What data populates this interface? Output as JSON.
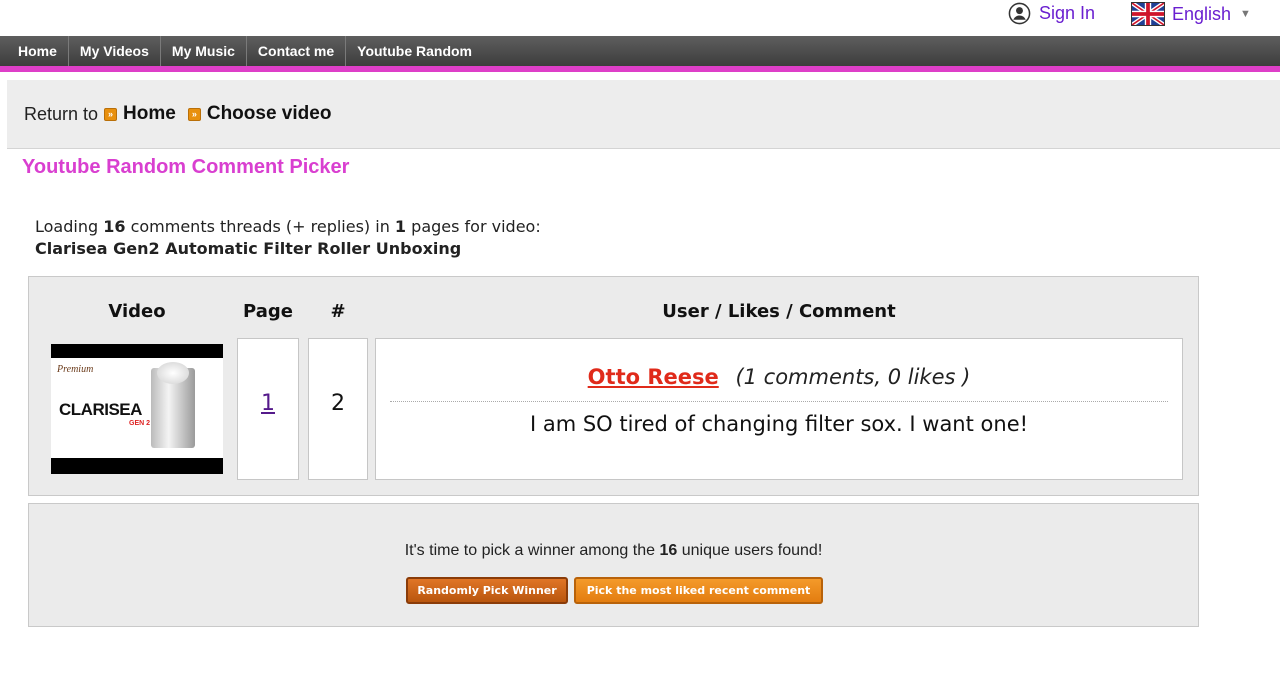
{
  "header": {
    "signin_label": "Sign In",
    "language_label": "English",
    "icons": {
      "signin": "user-circle-icon",
      "language": "uk-flag-icon",
      "caret": "chevron-down-icon"
    }
  },
  "nav": {
    "items": [
      {
        "label": "Home"
      },
      {
        "label": "My Videos"
      },
      {
        "label": "My Music"
      },
      {
        "label": "Contact me"
      },
      {
        "label": "Youtube Random"
      }
    ]
  },
  "breadcrumb": {
    "prefix": "Return to",
    "links": [
      {
        "label": "Home"
      },
      {
        "label": "Choose video"
      }
    ]
  },
  "title": "Youtube Random Comment Picker",
  "loading": {
    "text_1": "Loading",
    "comment_count": "16",
    "text_2": "comments threads (+ replies) in",
    "page_count": "1",
    "text_3": "pages for video:",
    "video_title": "Clarisea Gen2 Automatic Filter Roller Unboxing"
  },
  "results": {
    "columns": [
      {
        "label": "Video"
      },
      {
        "label": "Page"
      },
      {
        "label": "#"
      },
      {
        "label": "User / Likes / Comment"
      }
    ],
    "row": {
      "thumbnail_text": "CLARISEA",
      "thumbnail_subtext": "GEN 2",
      "page": "1",
      "number": "2",
      "user": "Otto Reese",
      "stats": "(1 comments, 0 likes )",
      "comment": "I am SO tired of changing filter sox. I want one!"
    }
  },
  "winner": {
    "text_1": "It's time to pick a winner among the",
    "unique_users": "16",
    "text_2": "unique users found!",
    "random_button": "Randomly Pick Winner",
    "liked_button": "Pick the most liked recent comment"
  },
  "colors": {
    "nav_accent": "#de3fc8",
    "title": "#d93fd0",
    "link": "#6a1fd0",
    "user_name": "#e02a1a",
    "button": "#e37d10"
  }
}
